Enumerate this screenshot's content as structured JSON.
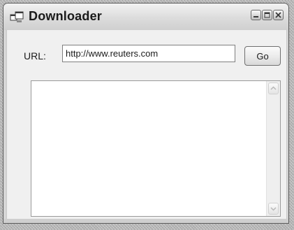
{
  "window": {
    "title": "Downloader",
    "icon": "app-window-icon",
    "buttons": [
      "minimize-icon",
      "maximize-icon",
      "close-icon"
    ]
  },
  "form": {
    "url_label": "URL:",
    "url_value": "http://www.reuters.com",
    "go_label": "Go"
  },
  "output": {
    "text": "",
    "scroll_up_icon": "chevron-up-icon",
    "scroll_down_icon": "chevron-down-icon"
  },
  "colors": {
    "titlebar": "#dcdcdc",
    "client": "#f0f0f0",
    "background": "#b4b4b4"
  }
}
